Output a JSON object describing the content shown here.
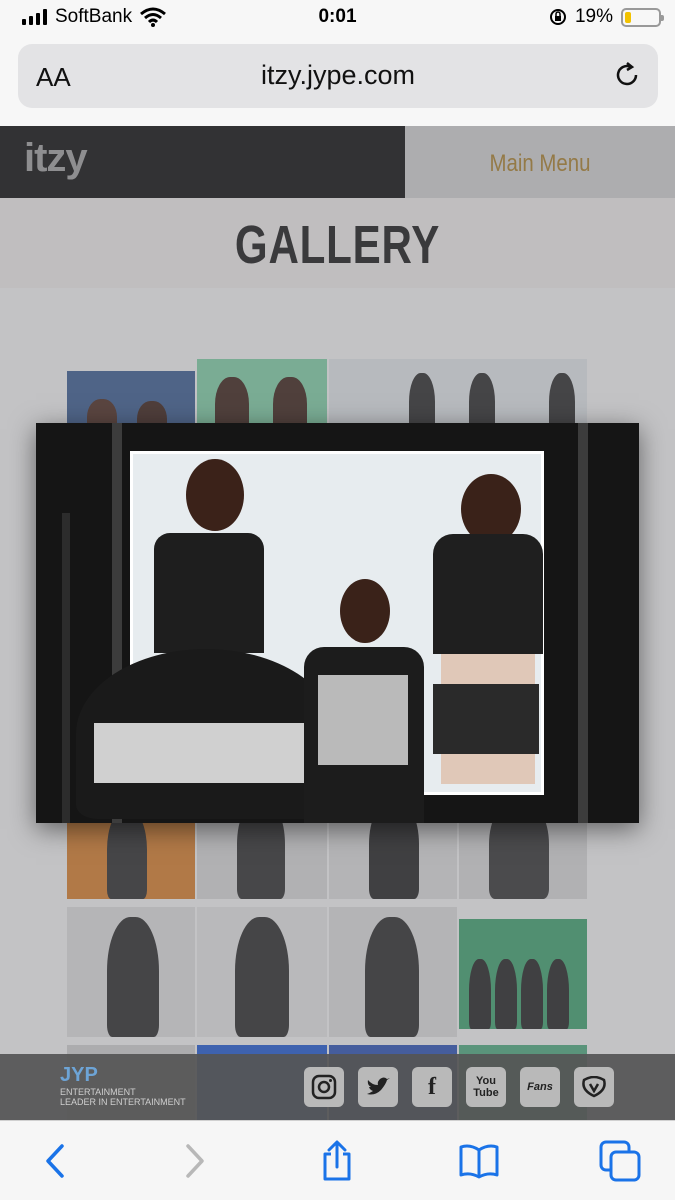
{
  "status_bar": {
    "carrier": "SoftBank",
    "time": "0:01",
    "battery": "19%",
    "battery_level": 0.19
  },
  "browser": {
    "text_size_label": "AA",
    "url": "itzy.jype.com"
  },
  "site": {
    "logo": "itzy",
    "main_menu": "Main Menu",
    "page_title": "GALLERY",
    "footer": {
      "agency_logo": "JYP",
      "agency_name": "ENTERTAINMENT",
      "agency_tagline": "LEADER IN ENTERTAINMENT",
      "social_icons": [
        "instagram-icon",
        "twitter-icon",
        "facebook-icon",
        "youtube-icon",
        "fans-icon",
        "v-live-icon"
      ],
      "social_labels": {
        "facebook": "f",
        "youtube": "You Tube",
        "fans": "Fans"
      }
    }
  },
  "colors": {
    "menu_text": "#a47b2a",
    "logo_bg": "#0d0d0d",
    "toolbar_accent": "#1a73e8"
  }
}
